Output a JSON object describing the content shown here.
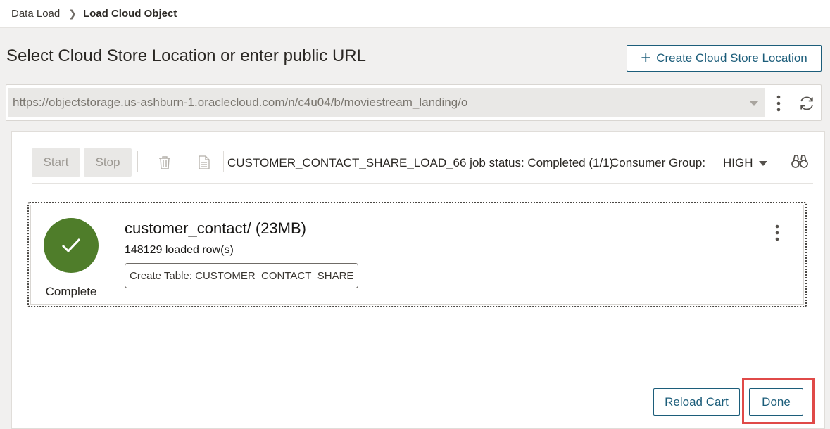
{
  "breadcrumb": {
    "parent": "Data Load",
    "current": "Load Cloud Object"
  },
  "header": {
    "title": "Select Cloud Store Location or enter public URL",
    "create_button": "Create Cloud Store Location"
  },
  "url_bar": {
    "value": "https://objectstorage.us-ashburn-1.oraclecloud.com/n/c4u04/b/moviestream_landing/o"
  },
  "toolbar": {
    "start_label": "Start",
    "stop_label": "Stop",
    "job_status": "CUSTOMER_CONTACT_SHARE_LOAD_66 job status: Completed (1/1)",
    "consumer_group_label": "Consumer Group:",
    "consumer_group_value": "HIGH"
  },
  "job": {
    "status": "Complete",
    "name": "customer_contact/ (23MB)",
    "rows": "148129 loaded row(s)",
    "action_tag": "Create Table: CUSTOMER_CONTACT_SHARE",
    "status_color": "#4f7d2a"
  },
  "footer": {
    "reload_label": "Reload Cart",
    "done_label": "Done"
  },
  "colors": {
    "accent": "#1c5d7a",
    "highlight": "#e04a48"
  }
}
